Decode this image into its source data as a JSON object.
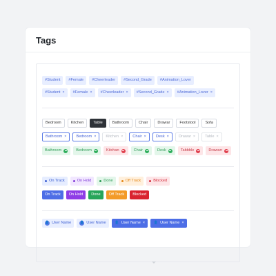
{
  "card": {
    "title": "Tags"
  },
  "hashtags_light": [
    "#Student",
    "#Female",
    "#Cheerleader",
    "#Second_Grade",
    "#Animation_Lover"
  ],
  "hashtags_removable": [
    "#Student",
    "#Female",
    "#Cheerleader",
    "#Second_Grade",
    "#Animation_Lover"
  ],
  "room_tags": [
    {
      "label": "Bedroom",
      "state": "default"
    },
    {
      "label": "Kitchen",
      "state": "default"
    },
    {
      "label": "Table",
      "state": "selected"
    },
    {
      "label": "Bathroom",
      "state": "default"
    },
    {
      "label": "Chair",
      "state": "default"
    },
    {
      "label": "Drawar",
      "state": "default"
    },
    {
      "label": "Footstool",
      "state": "default"
    },
    {
      "label": "Sofa",
      "state": "default"
    }
  ],
  "room_removable": [
    {
      "label": "Bathroom",
      "state": "active"
    },
    {
      "label": "Bedroom",
      "state": "active"
    },
    {
      "label": "Kitchen",
      "state": "disabled"
    },
    {
      "label": "Chair",
      "state": "active"
    },
    {
      "label": "Desk",
      "state": "active"
    },
    {
      "label": "Drawar",
      "state": "disabled"
    },
    {
      "label": "Table",
      "state": "disabled"
    }
  ],
  "room_status": [
    {
      "label": "Bathroom",
      "color": "green"
    },
    {
      "label": "Bedroom",
      "color": "green"
    },
    {
      "label": "Kitchan",
      "color": "red"
    },
    {
      "label": "Chair",
      "color": "green"
    },
    {
      "label": "Desk",
      "color": "green"
    },
    {
      "label": "Tabbble",
      "color": "red"
    },
    {
      "label": "Drawarr",
      "color": "red"
    }
  ],
  "status_light": [
    {
      "label": "On Track",
      "key": "ontrack",
      "dot": "#3d5fd2"
    },
    {
      "label": "On Hold",
      "key": "onhold",
      "dot": "#8540d9"
    },
    {
      "label": "Done",
      "key": "done",
      "dot": "#2f9d57"
    },
    {
      "label": "Off Track",
      "key": "offtrack",
      "dot": "#e58a1c"
    },
    {
      "label": "Blocked",
      "key": "blocked",
      "dot": "#d63341"
    }
  ],
  "status_solid": [
    {
      "label": "On Track",
      "key": "ontrack"
    },
    {
      "label": "On Hold",
      "key": "onhold"
    },
    {
      "label": "Done",
      "key": "done"
    },
    {
      "label": "Off Track",
      "key": "offtrack"
    },
    {
      "label": "Blocked",
      "key": "blocked"
    }
  ],
  "user_tags": [
    {
      "label": "User Name",
      "variant": "light"
    },
    {
      "label": "User Name",
      "variant": "light"
    },
    {
      "label": "User Name",
      "variant": "solid"
    },
    {
      "label": "User Name",
      "variant": "solid"
    }
  ],
  "icons": {
    "remove": "close-icon",
    "remove_glyph": "×",
    "user": "user-icon",
    "user_glyph": "👤"
  },
  "colors": {
    "accent": "#4d6ee6",
    "success": "#27a55a",
    "danger": "#d9242f",
    "warning": "#f39a28",
    "purple": "#8f3de6"
  }
}
